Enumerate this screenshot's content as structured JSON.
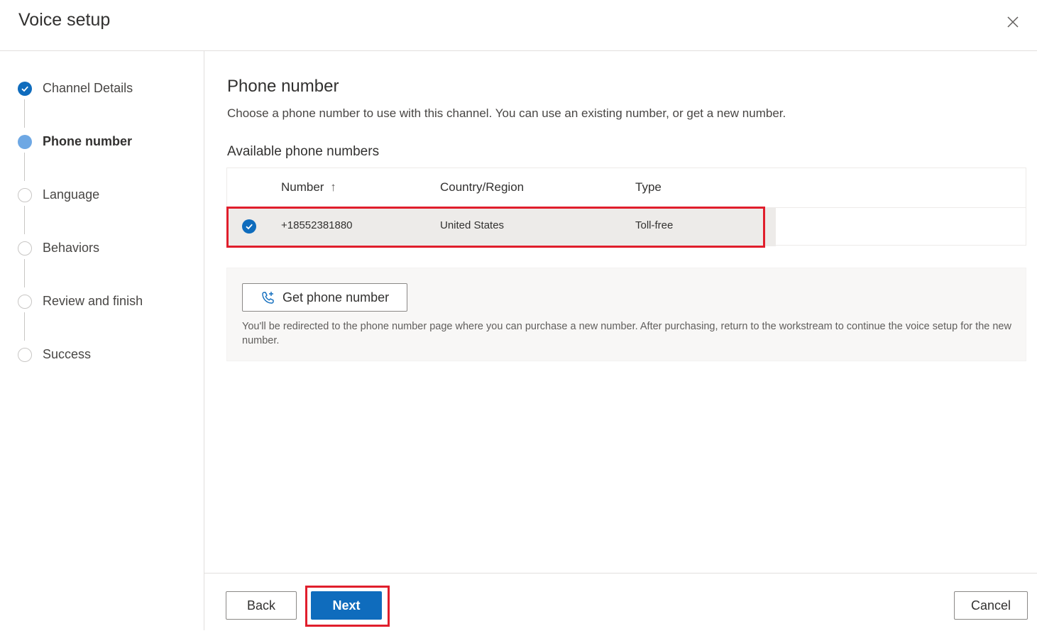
{
  "header": {
    "title": "Voice setup",
    "close_icon": "close-icon"
  },
  "steps": [
    {
      "label": "Channel Details",
      "state": "done"
    },
    {
      "label": "Phone number",
      "state": "current"
    },
    {
      "label": "Language",
      "state": "todo"
    },
    {
      "label": "Behaviors",
      "state": "todo"
    },
    {
      "label": "Review and finish",
      "state": "todo"
    },
    {
      "label": "Success",
      "state": "todo"
    }
  ],
  "main": {
    "title": "Phone number",
    "description": "Choose a phone number to use with this channel. You can use an existing number, or get a new number.",
    "section_title": "Available phone numbers",
    "table": {
      "columns": [
        "Number",
        "Country/Region",
        "Type"
      ],
      "sort_indicator": "↑",
      "rows": [
        {
          "number": "+18552381880",
          "country": "United States",
          "type": "Toll-free",
          "selected": true
        }
      ]
    },
    "get_number": {
      "button_label": "Get phone number",
      "info_text": "You'll be redirected to the phone number page where you can purchase a new number. After purchasing, return to the workstream to continue the voice setup for the new number."
    }
  },
  "footer": {
    "back_label": "Back",
    "next_label": "Next",
    "cancel_label": "Cancel"
  },
  "colors": {
    "accent": "#0f6cbd",
    "highlight": "#e01e2c",
    "row_selected": "#edebe9"
  }
}
